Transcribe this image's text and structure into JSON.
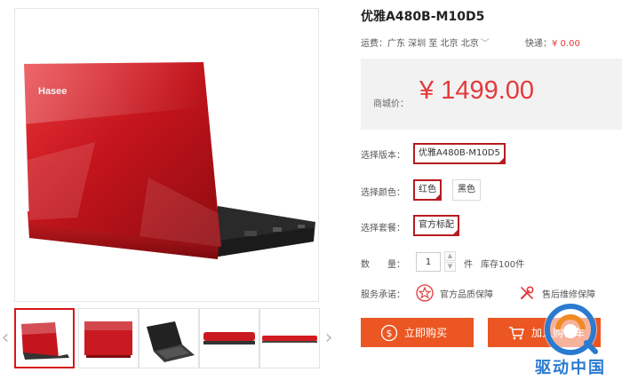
{
  "product": {
    "title": "优雅A480B-M10D5",
    "laptop_logo": "Hasee"
  },
  "shipping": {
    "label": "运费：",
    "route": "广东 深圳 至 北京 北京",
    "express_label": "快递：",
    "express_fee": "¥ 0.00"
  },
  "price": {
    "label": "商城价：",
    "value": "¥ 1499.00"
  },
  "options": {
    "version": {
      "label": "选择版本：",
      "choices": [
        "优雅A480B-M10D5"
      ],
      "selected": "优雅A480B-M10D5"
    },
    "color": {
      "label": "选择颜色：",
      "choices": [
        "红色",
        "黑色"
      ],
      "selected": "红色"
    },
    "package": {
      "label": "选择套餐：",
      "choices": [
        "官方标配"
      ],
      "selected": "官方标配"
    }
  },
  "quantity": {
    "label": "数　　量：",
    "value": "1",
    "unit": "件",
    "stock": "库存100件"
  },
  "promise": {
    "label": "服务承诺：",
    "items": [
      "官方品质保障",
      "售后维修保障"
    ]
  },
  "buttons": {
    "buy_now": "立即购买",
    "add_to_cart": "加入购物车"
  },
  "watermark": {
    "text": "驱动中国"
  },
  "icons": {
    "arrow_left": "‹",
    "arrow_right": "›",
    "chevron_down": "﹀",
    "qty_up": "▲",
    "qty_down": "▼"
  },
  "colors": {
    "accent_red": "#e4393c",
    "selected_border": "#b71c22",
    "button_orange": "#eb5622",
    "laptop_red": "#c4141c"
  }
}
